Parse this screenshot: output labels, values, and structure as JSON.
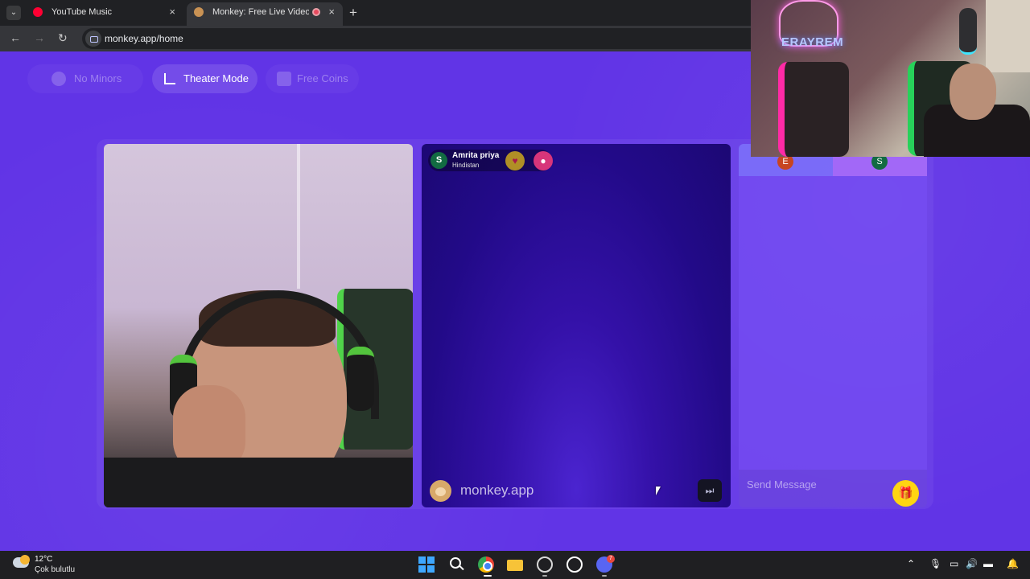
{
  "browser": {
    "tabs": [
      {
        "label": "YouTube Music",
        "active": false
      },
      {
        "label": "Monkey: Free Live Video Ch",
        "active": true
      }
    ],
    "new_tab": "+",
    "url": "monkey.app/home",
    "close_glyph": "×"
  },
  "page": {
    "pills": {
      "no_minors": "No Minors",
      "theater_mode": "Theater Mode",
      "free_coins": "Free Coins"
    },
    "peer": {
      "avatar_letter": "S",
      "name": "Amrita priya",
      "country": "Hindistan"
    },
    "brand": "monkey.app",
    "chat": {
      "left_avatar": "E",
      "right_avatar": "S",
      "placeholder": "Send Message"
    }
  },
  "overlay": {
    "neon_text": "ERAYREM"
  },
  "taskbar": {
    "temp": "12°C",
    "condition": "Çok bulutlu",
    "discord_badge": "7"
  },
  "colors": {
    "page_bg": "#6134e6",
    "chrome_dark": "#202124",
    "gift": "#ffd512"
  }
}
